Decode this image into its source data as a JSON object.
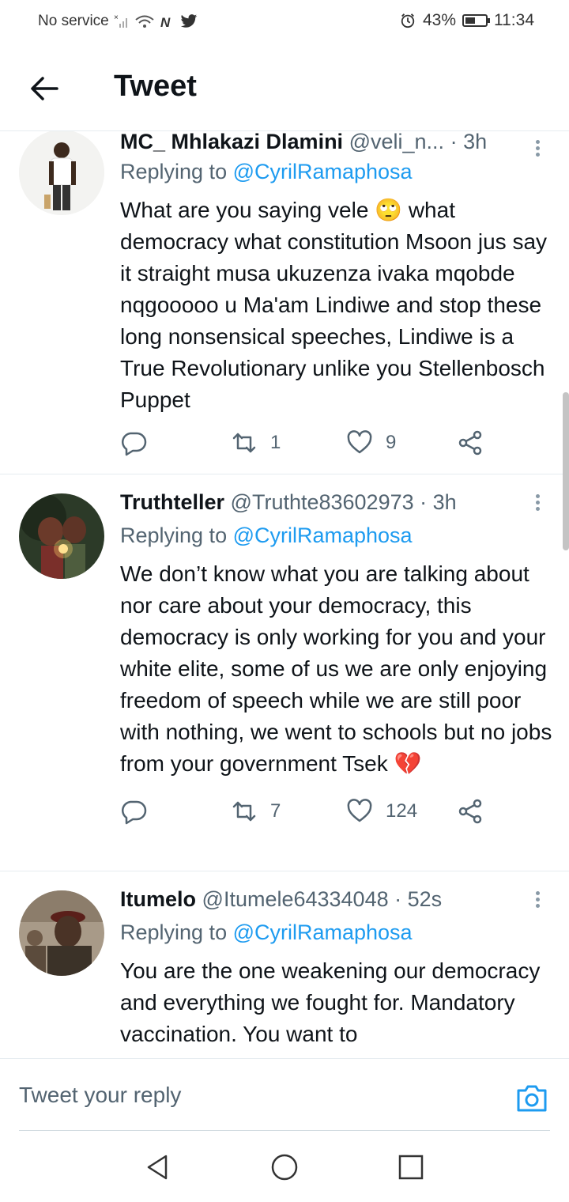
{
  "status_bar": {
    "carrier": "No service",
    "battery": "43%",
    "battery_level": 0.43,
    "time": "11:34",
    "icons": [
      "no-signal-icon",
      "wifi-icon",
      "nfc-icon",
      "twitter-icon",
      "alarm-icon",
      "battery-icon"
    ]
  },
  "header": {
    "title": "Tweet",
    "back_icon": "back-arrow-icon"
  },
  "tweets": [
    {
      "name": "MC_ Mhlakazi Dlamini",
      "handle": "@veli_n...",
      "time": "· 3h",
      "replying_prefix": "Replying to ",
      "replying_to": "@CyrilRamaphosa",
      "text_before_emoji": "What are you saying vele ",
      "emoji": "🙄",
      "text_after_emoji": " what democracy what constitution Msoon jus say it straight musa ukuzenza ivaka mqobde nqgooooo u Ma'am Lindiwe and stop these long nonsensical speeches, Lindiwe is a True Revolutionary unlike you Stellenbosch Puppet",
      "retweets": "1",
      "likes": "9"
    },
    {
      "name": "Truthteller",
      "handle": "@Truthte83602973",
      "time": "· 3h",
      "replying_prefix": "Replying to ",
      "replying_to": "@CyrilRamaphosa",
      "text": "We don’t know what you are talking about nor care about your democracy, this democracy is only working for you and your white elite, some of us we are only enjoying freedom of speech while we are still poor with nothing, we went to schools but no jobs from your government Tsek ",
      "emoji": "💔",
      "retweets": "7",
      "likes": "124"
    },
    {
      "name": "Itumelo",
      "handle": "@Itumele64334048",
      "time": "· 52s",
      "replying_prefix": "Replying to ",
      "replying_to": "@CyrilRamaphosa",
      "text": "You are the one weakening our democracy and everything we fought for. Mandatory vaccination. You want to"
    }
  ],
  "reply_bar": {
    "placeholder": "Tweet your reply",
    "camera_icon": "camera-icon"
  },
  "nav_bar": {
    "icons": [
      "nav-back-icon",
      "nav-home-icon",
      "nav-recents-icon"
    ]
  },
  "colors": {
    "accent": "#1d9bf0",
    "text": "#0f1419",
    "secondary": "#536471",
    "divider": "#e6ecf0"
  }
}
